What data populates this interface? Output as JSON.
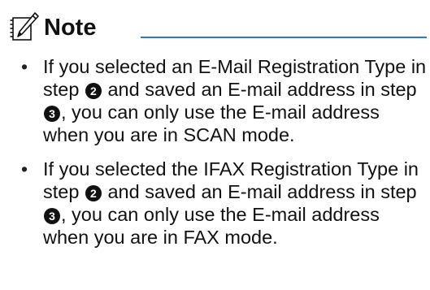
{
  "note": {
    "title": "Note",
    "icon": "pencil-note-icon",
    "rule_color": "#2d7bd1",
    "items": [
      {
        "p1": "If you selected an E-Mail Registration Type in step",
        "step_a": "2",
        "p2": "and saved an E-mail address in step",
        "step_b": "3",
        "p3": ", you can only use the E-mail address when you are in SCAN mode."
      },
      {
        "p1": "If you selected the IFAX Registration Type in step",
        "step_a": "2",
        "p2": "and saved an E-mail address in step",
        "step_b": "3",
        "p3": ", you can only use the E-mail address when you are in FAX mode."
      }
    ]
  }
}
